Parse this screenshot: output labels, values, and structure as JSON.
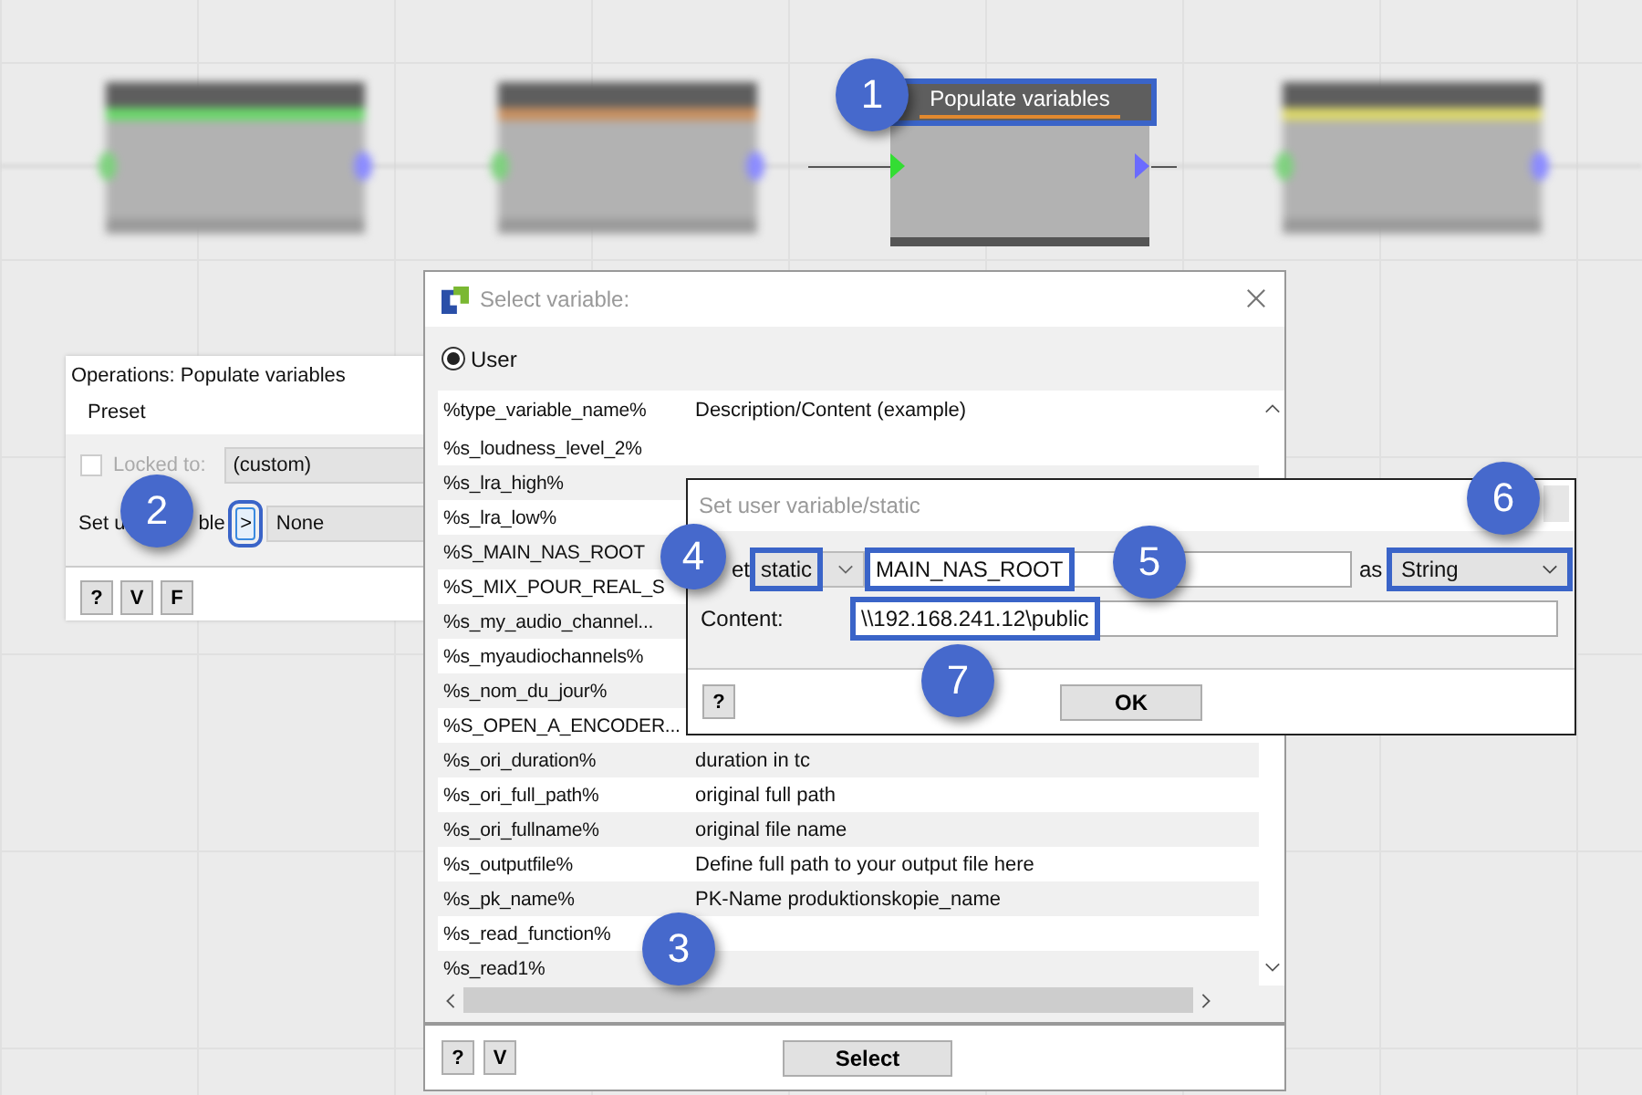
{
  "canvas": {
    "nodes": [
      {
        "kind": "blurred",
        "color": "#6ad86a"
      },
      {
        "kind": "blurred",
        "color": "#c89060"
      },
      {
        "kind": "clear",
        "title": "Populate variables",
        "color": "#e2892e",
        "highlighted": true,
        "callout": "1"
      },
      {
        "kind": "blurred",
        "color": "#dcd86a"
      }
    ]
  },
  "operations_panel": {
    "title": "Operations: Populate variables",
    "tab": "Preset",
    "locked": {
      "label": "Locked to:",
      "checked": false,
      "disabled": true,
      "value": "(custom)"
    },
    "set_variable": {
      "label_parts": [
        "Set u",
        "ble"
      ],
      "button": ">",
      "highlighted": true,
      "callout": "2",
      "value": "None"
    },
    "buttons": [
      "?",
      "V",
      "F"
    ]
  },
  "select_dialog": {
    "title": "Select variable:",
    "radio": {
      "label": "User",
      "selected": true
    },
    "table": {
      "columns": [
        "%type_variable_name%",
        "Description/Content (example)"
      ],
      "callout": "3",
      "rows": [
        {
          "name": "%s_loudness_level_2%"
        },
        {
          "name": "%s_lra_high%"
        },
        {
          "name": "%s_lra_low%"
        },
        {
          "name": "%S_MAIN_NAS_ROOT"
        },
        {
          "name": "%S_MIX_POUR_REAL_S"
        },
        {
          "name": "%s_my_audio_channel..."
        },
        {
          "name": "%s_myaudiochannels%"
        },
        {
          "name": "%s_nom_du_jour%"
        },
        {
          "name": "%S_OPEN_A_ENCODER..."
        },
        {
          "name": "%s_ori_duration%",
          "description": "duration in tc"
        },
        {
          "name": "%s_ori_full_path%",
          "description": "original full path"
        },
        {
          "name": "%s_ori_fullname%",
          "description": "original file name"
        },
        {
          "name": "%s_outputfile%",
          "description": "Define full path to your output file here"
        },
        {
          "name": "%s_pk_name%",
          "description": "PK-Name produktionskopie_name"
        },
        {
          "name": "%s_read_function%"
        },
        {
          "name": "%s_read1%"
        }
      ]
    },
    "buttons": [
      "?",
      "V"
    ],
    "primary": "Select"
  },
  "set_dialog": {
    "title": "Set user variable/static",
    "set_label": "et",
    "scope": {
      "value": "static",
      "highlighted": true,
      "callout": "4"
    },
    "name": {
      "value": "MAIN_NAS_ROOT",
      "highlighted": true,
      "callout": "5"
    },
    "as_label": "as",
    "type": {
      "value": "String",
      "highlighted": true,
      "callout": "6"
    },
    "content_label": "Content:",
    "content": {
      "value": "\\\\192.168.241.12\\public",
      "highlighted": true,
      "callout": "7"
    },
    "buttons": [
      "?"
    ],
    "primary": "OK"
  }
}
